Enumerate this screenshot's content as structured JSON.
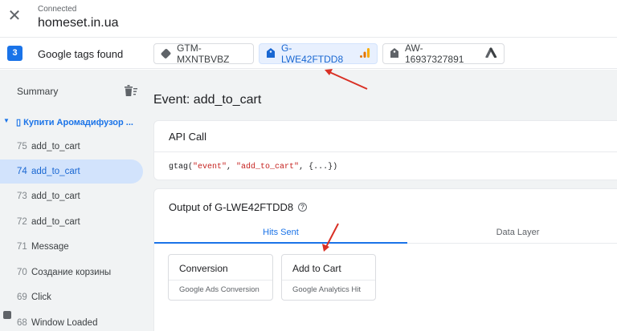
{
  "header": {
    "status": "Connected",
    "domain": "homeset.in.ua"
  },
  "tags_bar": {
    "count": "3",
    "label": "Google tags found",
    "tags": [
      {
        "id": "GTM-MXNTBVBZ",
        "icon": "gtm-diamond-icon"
      },
      {
        "id": "G-LWE42FTDD8",
        "icon": "google-analytics-icon",
        "active": true
      },
      {
        "id": "AW-16937327891",
        "icon": "google-ads-icon"
      }
    ]
  },
  "sidebar": {
    "summary_label": "Summary",
    "page_title": "▯ Купити Аромадифузор ...",
    "items": [
      {
        "num": "75",
        "name": "add_to_cart"
      },
      {
        "num": "74",
        "name": "add_to_cart",
        "selected": true
      },
      {
        "num": "73",
        "name": "add_to_cart"
      },
      {
        "num": "72",
        "name": "add_to_cart"
      },
      {
        "num": "71",
        "name": "Message"
      },
      {
        "num": "70",
        "name": "Создание корзины"
      },
      {
        "num": "69",
        "name": "Click"
      },
      {
        "num": "68",
        "name": "Window Loaded"
      }
    ]
  },
  "main": {
    "event_title": "Event: add_to_cart",
    "api_call": {
      "heading": "API Call",
      "code_fn": "gtag(",
      "code_arg1": "\"event\"",
      "code_sep": ", ",
      "code_arg2": "\"add_to_cart\"",
      "code_end": ", {...})"
    },
    "output": {
      "heading": "Output of G-LWE42FTDD8",
      "tabs": [
        "Hits Sent",
        "Data Layer"
      ],
      "hits": [
        {
          "name": "Conversion",
          "type": "Google Ads Conversion"
        },
        {
          "name": "Add to Cart",
          "type": "Google Analytics Hit"
        }
      ]
    }
  },
  "colors": {
    "accent": "#1a73e8",
    "annotation_arrow": "#d93025",
    "ga_orange": "#f9ab00",
    "ga_dark_orange": "#e37400"
  }
}
